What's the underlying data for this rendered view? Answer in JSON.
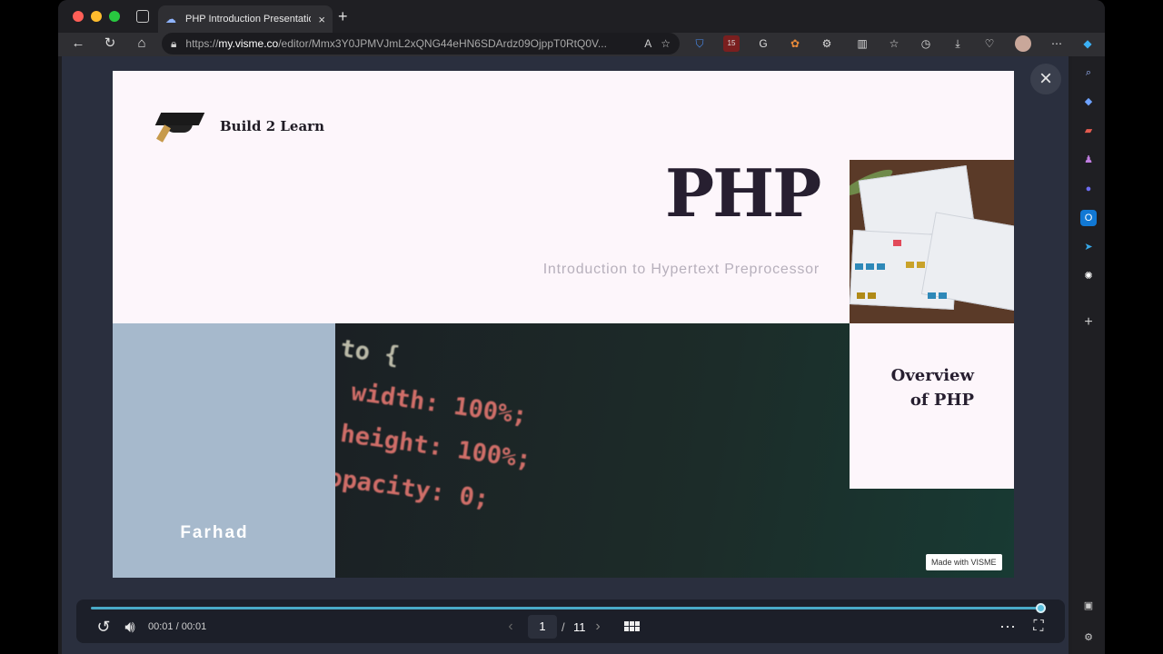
{
  "browser": {
    "tab_title": "PHP Introduction Presentation",
    "tab_close": "×",
    "new_tab": "+",
    "url_prefix": "https://",
    "url_host": "my.visme.co",
    "url_path": "/editor/Mmx3Y0JPMVJmL2xQNG44eHN6SDArdz09OjppT0RtQ0V...",
    "reader_icon": "A",
    "extension_badge": "15"
  },
  "slide": {
    "brand": "Build 2 Learn",
    "title": "PHP",
    "subtitle": "Introduction to Hypertext Preprocessor",
    "author": "Farhad",
    "overview_line1": "Overview",
    "overview_line2": "of PHP",
    "code_lines": [
      "to {",
      "width: 100%;",
      "height: 100%;",
      "opacity: 0;"
    ],
    "watermark": "Made with VISME"
  },
  "player": {
    "time": "00:01 / 00:01",
    "current_page": "1",
    "page_separator": "/",
    "total_pages": "11",
    "progress": 1.0
  },
  "colors": {
    "accent": "#49a9c6",
    "slide_bg": "#fdf6fb",
    "author_panel": "#a6b9cc",
    "title_text": "#271f30"
  },
  "icons": [
    "back-icon",
    "reload-icon",
    "home-icon",
    "lock-icon",
    "favorite-icon",
    "close-icon",
    "replay-icon",
    "volume-icon",
    "prev-icon",
    "next-icon",
    "grid-icon",
    "more-icon",
    "fullscreen-icon"
  ]
}
